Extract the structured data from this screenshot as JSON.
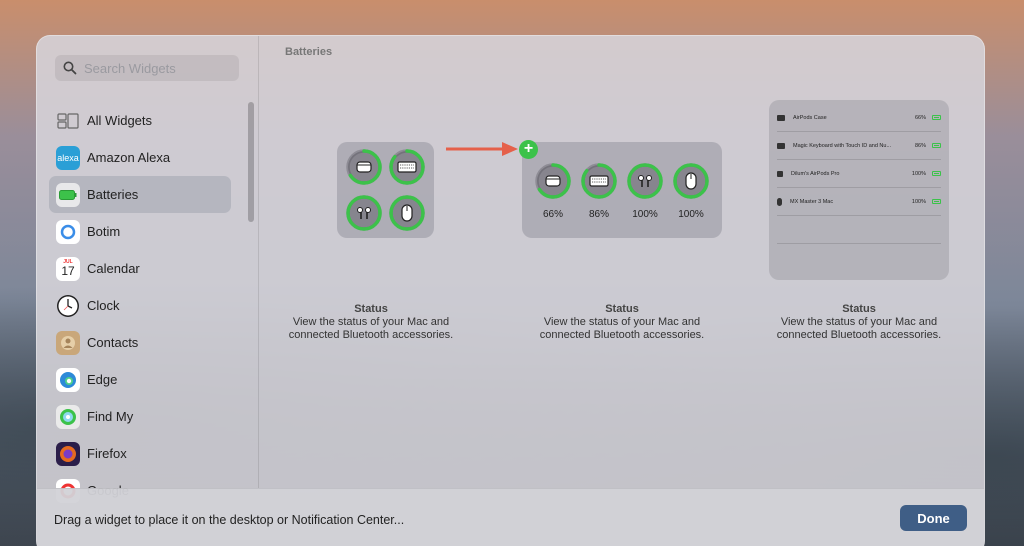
{
  "search": {
    "placeholder": "Search Widgets"
  },
  "sidebar": {
    "items": [
      {
        "label": "All Widgets",
        "icon": "all-widgets-icon",
        "selected": false
      },
      {
        "label": "Amazon Alexa",
        "icon": "alexa-icon",
        "icon_text": "alexa",
        "color": "#2a9fd6"
      },
      {
        "label": "Batteries",
        "icon": "battery-icon",
        "selected": true,
        "color": "#3cc24a"
      },
      {
        "label": "Botim",
        "icon": "botim-icon",
        "color": "#3a8de8"
      },
      {
        "label": "Calendar",
        "icon": "calendar-icon",
        "icon_month": "JUL",
        "icon_day": "17"
      },
      {
        "label": "Clock",
        "icon": "clock-icon"
      },
      {
        "label": "Contacts",
        "icon": "contacts-icon",
        "color": "#c9a77a"
      },
      {
        "label": "Edge",
        "icon": "edge-icon",
        "color": "#2d8ad8"
      },
      {
        "label": "Find My",
        "icon": "find-my-icon",
        "color": "#3cc24a"
      },
      {
        "label": "Firefox",
        "icon": "firefox-icon",
        "color": "#e66a1f"
      },
      {
        "label": "Google",
        "icon": "google-icon"
      }
    ]
  },
  "main": {
    "section_title": "Batteries",
    "medium_widget": {
      "percentages": [
        "66%",
        "86%",
        "100%",
        "100%"
      ],
      "levels": [
        0.66,
        0.86,
        1.0,
        1.0
      ]
    },
    "small_widget": {
      "levels": [
        0.66,
        0.86,
        1.0,
        1.0
      ]
    },
    "large_widget": {
      "rows": [
        {
          "name": "AirPods Case",
          "level": "66%"
        },
        {
          "name": "Magic Keyboard with Touch ID and Nu...",
          "level": "86%"
        },
        {
          "name": "Dilum's AirPods Pro",
          "level": "100%"
        },
        {
          "name": "MX Master 3 Mac",
          "level": "100%"
        }
      ]
    },
    "captions": [
      {
        "title": "Status",
        "desc": "View the status of your Mac and connected Bluetooth accessories."
      },
      {
        "title": "Status",
        "desc": "View the status of your Mac and connected Bluetooth accessories."
      },
      {
        "title": "Status",
        "desc": "View the status of your Mac and connected Bluetooth accessories."
      }
    ]
  },
  "bottom": {
    "hint": "Drag a widget to place it on the desktop or Notification Center...",
    "done_label": "Done"
  },
  "colors": {
    "accent_green": "#3cc24a",
    "done_button": "#3f5e86",
    "arrow": "#e5604a"
  }
}
